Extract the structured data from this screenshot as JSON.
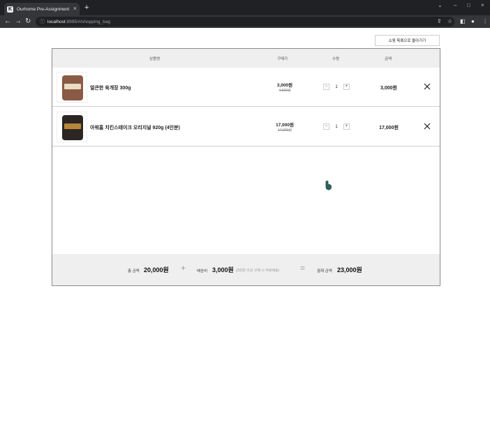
{
  "browser": {
    "tab_title": "Ourhome Pre-Assignment",
    "tab_favicon": "K",
    "url_host": "localhost",
    "url_rest": ":8995/#/shopping_bag",
    "icons": {
      "close": "×",
      "new_tab": "+",
      "minimize": "–",
      "maximize": "□",
      "win_close": "×",
      "back": "←",
      "forward": "→",
      "reload": "↻",
      "lock": "ⓘ",
      "share": "⇪",
      "star": "☆",
      "sidebar": "◧",
      "profile": "●",
      "menu": "⋮",
      "tab_search": "⌄"
    }
  },
  "page": {
    "back_button_label": "쇼핑 목록으로 돌아가기",
    "columns": {
      "product": "상품명",
      "price": "구매가",
      "quantity": "수량",
      "amount": "금액"
    },
    "items": [
      {
        "name": "얼큰한 육개장 300g",
        "price": "3,000원",
        "original_price": "4,500원",
        "quantity": "1",
        "amount": "3,000원",
        "thumb_color": "#8a5a44",
        "label_color": "#e9dcc3"
      },
      {
        "name": "아워홈 치킨스테이크 오리지널 920g (4인분)",
        "price": "17,000원",
        "original_price": "17,900원",
        "quantity": "1",
        "amount": "17,000원",
        "thumb_color": "#2b2623",
        "label_color": "#b8863b"
      }
    ],
    "qty_minus": "−",
    "qty_plus": "+",
    "summary": {
      "total_label": "총 금액",
      "total_value": "20,000원",
      "plus_sign": "+",
      "shipping_label": "배송비",
      "shipping_value": "3,000원",
      "shipping_note": "(3만원 이상 구매 시 무료배송)",
      "equals_sign": "=",
      "pay_label": "결제 금액",
      "pay_value": "23,000원"
    }
  },
  "colors": {
    "cursor": "#2f5f5a"
  }
}
